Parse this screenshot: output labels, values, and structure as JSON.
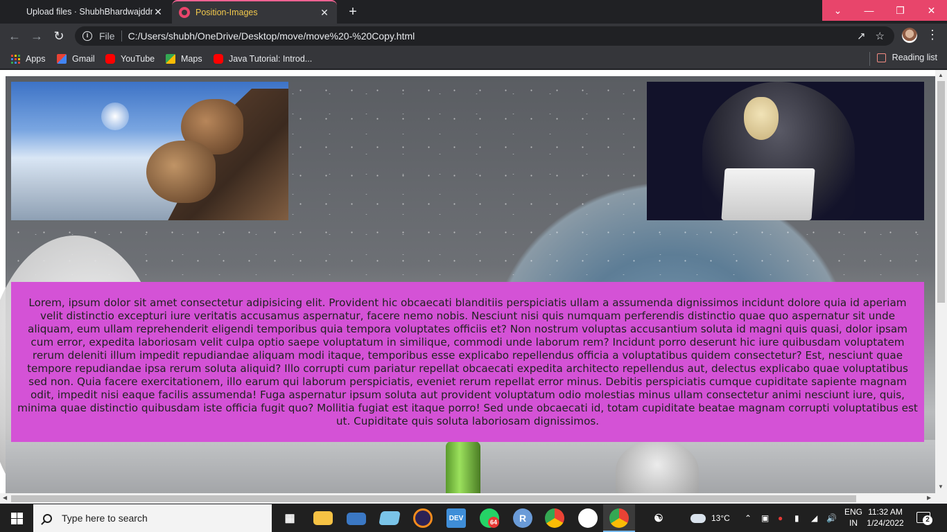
{
  "browser": {
    "tabs": [
      {
        "title": "Upload files · ShubhBhardwajddn",
        "close": "✕"
      },
      {
        "title": "Position-Images",
        "close": "✕"
      }
    ],
    "new_tab": "+",
    "window_controls": {
      "dropdown": "⌄",
      "minimize": "—",
      "restore": "❐",
      "close": "✕"
    },
    "address": {
      "scheme_label": "File",
      "url": "C:/Users/shubh/OneDrive/Desktop/move/move%20-%20Copy.html"
    },
    "bookmarks": [
      {
        "label": "Apps",
        "icon": "apps-grid-icon"
      },
      {
        "label": "Gmail",
        "icon": "gmail-icon"
      },
      {
        "label": "YouTube",
        "icon": "youtube-icon"
      },
      {
        "label": "Maps",
        "icon": "maps-icon"
      },
      {
        "label": "Java Tutorial: Introd...",
        "icon": "youtube-icon"
      }
    ],
    "reading_list": "Reading list"
  },
  "page": {
    "paragraph": "Lorem, ipsum dolor sit amet consectetur adipisicing elit. Provident hic obcaecati blanditiis perspiciatis ullam a assumenda dignissimos incidunt dolore quia id aperiam velit distinctio excepturi iure veritatis accusamus aspernatur, facere nemo nobis. Nesciunt nisi quis numquam perferendis distinctio quae quo aspernatur sit unde aliquam, eum ullam reprehenderit eligendi temporibus quia tempora voluptates officiis et? Non nostrum voluptas accusantium soluta id magni quis quasi, dolor ipsam cum error, expedita laboriosam velit culpa optio saepe voluptatum in similique, commodi unde laborum rem? Incidunt porro deserunt hic iure quibusdam voluptatem rerum deleniti illum impedit repudiandae aliquam modi itaque, temporibus esse explicabo repellendus officia a voluptatibus quidem consectetur? Est, nesciunt quae tempore repudiandae ipsa rerum soluta aliquid? Illo corrupti cum pariatur repellat obcaecati expedita architecto repellendus aut, delectus explicabo quae voluptatibus sed non. Quia facere exercitationem, illo earum qui laborum perspiciatis, eveniet rerum repellat error minus. Debitis perspiciatis cumque cupiditate sapiente magnam odit, impedit nisi eaque facilis assumenda! Fuga aspernatur ipsum soluta aut provident voluptatum odio molestias minus ullam consectetur animi nesciunt iure, quis, minima quae distinctio quibusdam iste officia fugit quo? Mollitia fugiat est itaque porro! Sed unde obcaecati id, totam cupiditate beatae magnam corrupti voluptatibus est ut. Cupiditate quis soluta laboriosam dignissimos.",
    "text_box_color": "#d452d6"
  },
  "taskbar": {
    "search_placeholder": "Type here to search",
    "whatsapp_badge": "64",
    "dev_label": "DEV",
    "r_label": "R",
    "weather": "13°C",
    "language": {
      "line1": "ENG",
      "line2": "IN"
    },
    "clock": {
      "time": "11:32 AM",
      "date": "1/24/2022"
    },
    "notifications": "2"
  },
  "colors": {
    "accent_tab": "#f2c94c",
    "window_controls": "#e8456b"
  }
}
